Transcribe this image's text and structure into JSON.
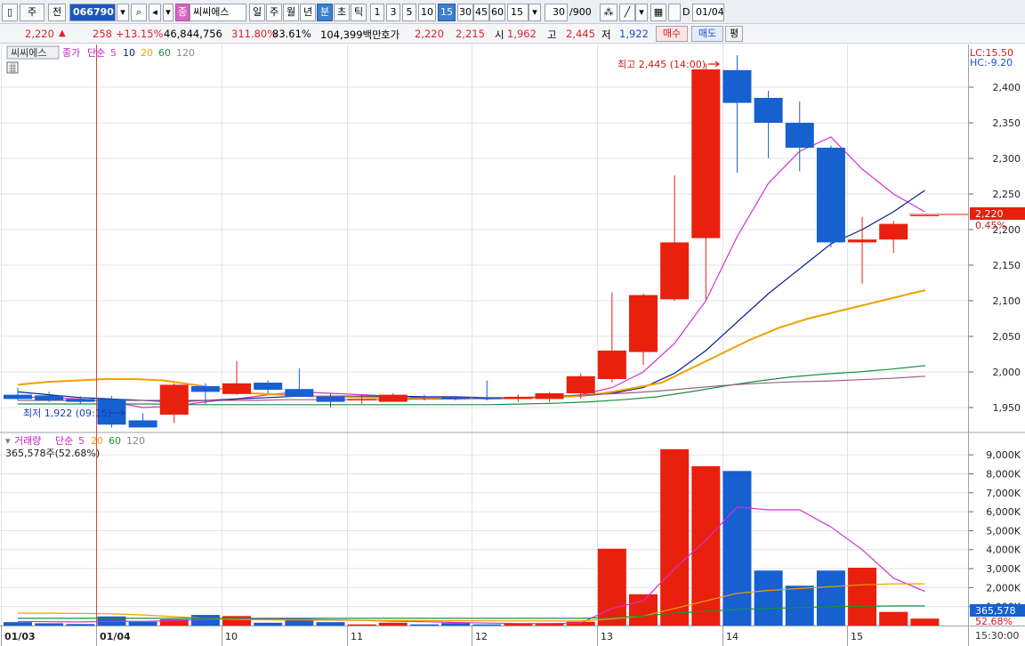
{
  "toolbar": {
    "period_type": "주",
    "prev_label": "전",
    "code": "066790",
    "stock_name": "씨씨에스",
    "jong_label": "종",
    "tabs": [
      "일",
      "주",
      "월",
      "년",
      "분",
      "초",
      "틱"
    ],
    "selected_tab": "분",
    "intervals": [
      "1",
      "3",
      "5",
      "10",
      "15",
      "30",
      "45",
      "60"
    ],
    "selected_interval": "15",
    "interval_value": "15",
    "count_value": "30",
    "count_max": "/900",
    "checkbox_label": "D",
    "date_value": "01/04"
  },
  "quote": {
    "price": "2,220",
    "change_arrow": "▲",
    "change": "258",
    "change_pct": "+13.15%",
    "volume": "46,844,756",
    "volume_ratio": "311.80%",
    "rate": "83.61%",
    "amount": "104,399백만",
    "hoga_label": "호가",
    "ask": "2,220",
    "bid": "2,215",
    "open_label": "시",
    "open": "1,962",
    "high_label": "고",
    "high": "2,445",
    "low_label": "저",
    "low": "1,922",
    "buy_label": "매수",
    "sell_label": "매도",
    "eval_label": "평"
  },
  "price_legend": {
    "name": "씨씨에스",
    "close_label": "종가",
    "ma_type": "단순",
    "periods": [
      "5",
      "10",
      "20",
      "60",
      "120"
    ]
  },
  "volume_legend": {
    "name": "거래량",
    "ma_type": "단순",
    "periods": [
      "5",
      "20",
      "60",
      "120"
    ],
    "current": "365,578주(52.68%)"
  },
  "annotations": {
    "high_text": "최고 2,445 (14:00)",
    "low_text": "최저 1,922 (09:15)",
    "lc": "LC:15.50",
    "hc": "HC:-9.20",
    "price_tag": "2,220",
    "price_tag_pct": "0.45%",
    "volume_tag": "365,578",
    "volume_tag_pct": "52.68%",
    "time_label": "15:30:00"
  },
  "colors": {
    "up": "#e8200e",
    "down": "#1660d0",
    "ma5": "#d62ed0",
    "ma10": "#0a1e90",
    "ma20": "#f0a000",
    "ma60": "#1a9040",
    "ma120": "#9a6080",
    "grid": "#dfe3e8",
    "cursor": "#e04040"
  },
  "chart_data": [
    {
      "type": "candlestick",
      "title": "씨씨에스",
      "x_date_labels": [
        "01/03",
        "01/04",
        "10",
        "11",
        "12",
        "13",
        "14",
        "15"
      ],
      "y_ticks": [
        "2,400",
        "2,350",
        "2,300",
        "2,250",
        "2,200",
        "2,150",
        "2,100",
        "2,050",
        "2,000",
        "1,950"
      ],
      "ylim": [
        1915,
        2460
      ],
      "grid": true,
      "candles": [
        {
          "o": 1968,
          "h": 1978,
          "l": 1960,
          "c": 1962
        },
        {
          "o": 1967,
          "h": 1972,
          "l": 1958,
          "c": 1960
        },
        {
          "o": 1962,
          "h": 1966,
          "l": 1955,
          "c": 1958
        },
        {
          "o": 1962,
          "h": 1966,
          "l": 1922,
          "c": 1926
        },
        {
          "o": 1932,
          "h": 1942,
          "l": 1926,
          "c": 1922
        },
        {
          "o": 1940,
          "h": 1984,
          "l": 1928,
          "c": 1982
        },
        {
          "o": 1980,
          "h": 1984,
          "l": 1955,
          "c": 1972
        },
        {
          "o": 1969,
          "h": 2015,
          "l": 1968,
          "c": 1984
        },
        {
          "o": 1985,
          "h": 1988,
          "l": 1970,
          "c": 1975
        },
        {
          "o": 1976,
          "h": 2005,
          "l": 1965,
          "c": 1965
        },
        {
          "o": 1966,
          "h": 1970,
          "l": 1950,
          "c": 1958
        },
        {
          "o": 1960,
          "h": 1968,
          "l": 1955,
          "c": 1962
        },
        {
          "o": 1958,
          "h": 1970,
          "l": 1958,
          "c": 1968
        },
        {
          "o": 1965,
          "h": 1968,
          "l": 1960,
          "c": 1964
        },
        {
          "o": 1964,
          "h": 1966,
          "l": 1960,
          "c": 1962
        },
        {
          "o": 1964,
          "h": 1988,
          "l": 1960,
          "c": 1962
        },
        {
          "o": 1962,
          "h": 1968,
          "l": 1958,
          "c": 1965
        },
        {
          "o": 1962,
          "h": 1972,
          "l": 1958,
          "c": 1970
        },
        {
          "o": 1970,
          "h": 1998,
          "l": 1962,
          "c": 1994
        },
        {
          "o": 1990,
          "h": 2112,
          "l": 1985,
          "c": 2030
        },
        {
          "o": 2028,
          "h": 2110,
          "l": 2010,
          "c": 2108
        },
        {
          "o": 2102,
          "h": 2276,
          "l": 2100,
          "c": 2182
        },
        {
          "o": 2188,
          "h": 2433,
          "l": 2102,
          "c": 2425
        },
        {
          "o": 2424,
          "h": 2445,
          "l": 2280,
          "c": 2378
        },
        {
          "o": 2385,
          "h": 2395,
          "l": 2300,
          "c": 2350
        },
        {
          "o": 2350,
          "h": 2380,
          "l": 2282,
          "c": 2315
        },
        {
          "o": 2315,
          "h": 2318,
          "l": 2175,
          "c": 2182
        },
        {
          "o": 2182,
          "h": 2218,
          "l": 2124,
          "c": 2186
        },
        {
          "o": 2186,
          "h": 2212,
          "l": 2167,
          "c": 2208
        },
        {
          "o": 2220,
          "h": 2220,
          "l": 2220,
          "c": 2220
        }
      ],
      "series": [
        {
          "name": "5",
          "values": [
            1965,
            1964,
            1962,
            1958,
            1950,
            1952,
            1958,
            1962,
            1968,
            1972,
            1970,
            1968,
            1966,
            1965,
            1964,
            1962,
            1963,
            1964,
            1968,
            1978,
            2000,
            2040,
            2100,
            2190,
            2265,
            2310,
            2330,
            2285,
            2250,
            2225
          ]
        },
        {
          "name": "10",
          "values": [
            1972,
            1968,
            1964,
            1962,
            1960,
            1958,
            1960,
            1962,
            1964,
            1966,
            1966,
            1966,
            1966,
            1965,
            1965,
            1964,
            1964,
            1964,
            1966,
            1970,
            1978,
            1998,
            2030,
            2070,
            2110,
            2145,
            2180,
            2200,
            2225,
            2255
          ]
        },
        {
          "name": "20",
          "values": [
            1982,
            1986,
            1988,
            1990,
            1990,
            1988,
            1982,
            1976,
            1970,
            1968,
            1966,
            1965,
            1964,
            1963,
            1963,
            1963,
            1963,
            1964,
            1964,
            1966,
            1970,
            1977,
            1985,
            2005,
            2025,
            2045,
            2062,
            2075,
            2085,
            2095,
            2105,
            2115
          ]
        },
        {
          "name": "60",
          "values": [
            1955,
            1955,
            1955,
            1955,
            1955,
            1954,
            1954,
            1954,
            1954,
            1954,
            1954,
            1954,
            1954,
            1954,
            1954,
            1955,
            1956,
            1958,
            1961,
            1965,
            1972,
            1980,
            1987,
            1993,
            1997,
            2000,
            2004,
            2009
          ]
        },
        {
          "name": "120",
          "values": [
            1960,
            1960,
            1960,
            1960,
            1960,
            1960,
            1960,
            1960,
            1961,
            1961,
            1961,
            1961,
            1962,
            1962,
            1963,
            1964,
            1966,
            1968,
            1970,
            1973,
            1977,
            1981,
            1984,
            1986,
            1987,
            1989,
            1991,
            1994
          ]
        }
      ]
    },
    {
      "type": "bar",
      "title": "거래량",
      "y_ticks": [
        "9,000K",
        "8,000K",
        "7,000K",
        "6,000K",
        "5,000K",
        "4,000K",
        "3,000K",
        "2,000K",
        "1,000K"
      ],
      "ylim": [
        0,
        9900
      ],
      "values": [
        180,
        120,
        80,
        480,
        200,
        330,
        560,
        500,
        150,
        330,
        180,
        60,
        150,
        60,
        130,
        60,
        100,
        120,
        200,
        4050,
        1650,
        9300,
        8400,
        8150,
        2900,
        2100,
        2900,
        3050,
        720,
        366
      ],
      "series": [
        {
          "name": "5",
          "values": [
            220,
            200,
            190,
            230,
            220,
            260,
            320,
            350,
            340,
            330,
            300,
            270,
            230,
            200,
            160,
            130,
            110,
            110,
            130,
            900,
            1300,
            3000,
            4500,
            6250,
            6100,
            6100,
            5200,
            4000,
            2500,
            1800
          ]
        },
        {
          "name": "20",
          "values": [
            650,
            650,
            640,
            620,
            560,
            470,
            380,
            320,
            300,
            290,
            280,
            270,
            265,
            260,
            255,
            250,
            245,
            240,
            240,
            350,
            500,
            900,
            1300,
            1700,
            1850,
            1950,
            2050,
            2150,
            2200,
            2200
          ]
        },
        {
          "name": "60",
          "values": [
            380,
            380,
            380,
            380,
            380,
            380,
            380,
            380,
            380,
            380,
            380,
            380,
            380,
            380,
            380,
            380,
            380,
            380,
            380,
            420,
            500,
            650,
            750,
            850,
            900,
            950,
            1000,
            1020,
            1030,
            1030
          ]
        }
      ]
    }
  ]
}
